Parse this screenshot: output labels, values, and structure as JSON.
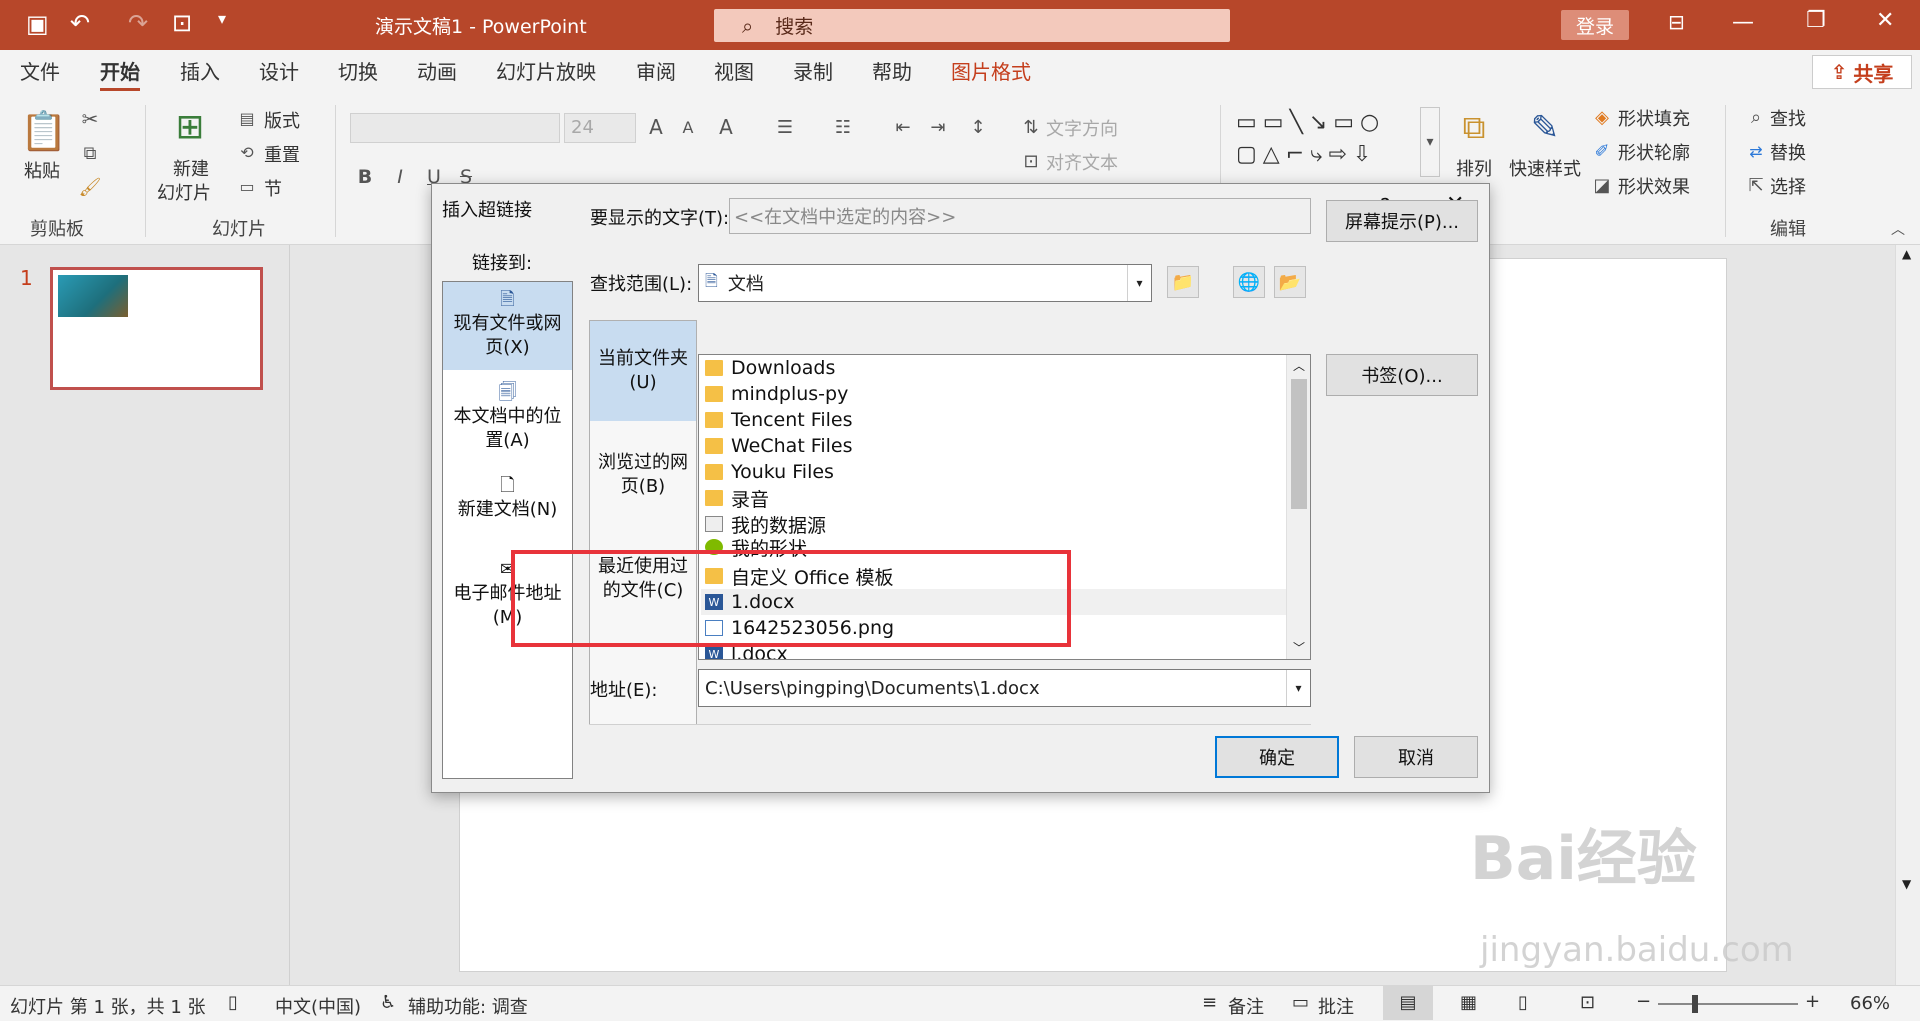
{
  "titlebar": {
    "doc_title": "演示文稿1  -  PowerPoint",
    "search_placeholder": "搜索",
    "login": "登录"
  },
  "tabs": [
    "文件",
    "开始",
    "插入",
    "设计",
    "切换",
    "动画",
    "幻灯片放映",
    "审阅",
    "视图",
    "录制",
    "帮助",
    "图片格式"
  ],
  "share": "共享",
  "ribbon": {
    "paste": "粘贴",
    "clipboard_group": "剪贴板",
    "new_slide_1": "新建",
    "new_slide_2": "幻灯片",
    "layout": "版式",
    "reset": "重置",
    "section": "节",
    "slides_group": "幻灯片",
    "font_size": "24",
    "text_direction": "文字方向",
    "align_text": "对齐文本",
    "arrange": "排列",
    "quick_styles": "快速样式",
    "shape_fill": "形状填充",
    "shape_outline": "形状轮廓",
    "shape_effects": "形状效果",
    "find": "查找",
    "replace": "替换",
    "select": "选择",
    "editing_group": "编辑"
  },
  "slide_number": "1",
  "dialog": {
    "title": "插入超链接",
    "help": "?",
    "close": "✕",
    "link_to": "链接到:",
    "link_items": [
      "现有文件或网页(X)",
      "本文档中的位置(A)",
      "新建文档(N)",
      "电子邮件地址(M)"
    ],
    "display_text_label": "要显示的文字(T):",
    "display_text_value": "<<在文档中选定的内容>>",
    "screen_tip": "屏幕提示(P)...",
    "look_in_label": "查找范围(L):",
    "look_in_value": "文档",
    "scope_items": [
      "当前文件夹(U)",
      "浏览过的网页(B)",
      "最近使用过的文件(C)"
    ],
    "files": [
      {
        "name": "Downloads",
        "type": "folder"
      },
      {
        "name": "mindplus-py",
        "type": "folder"
      },
      {
        "name": "Tencent Files",
        "type": "folder"
      },
      {
        "name": "WeChat Files",
        "type": "folder"
      },
      {
        "name": "Youku Files",
        "type": "folder"
      },
      {
        "name": "录音",
        "type": "folder"
      },
      {
        "name": "我的数据源",
        "type": "db"
      },
      {
        "name": "我的形状",
        "type": "shape"
      },
      {
        "name": "自定义 Office 模板",
        "type": "folder"
      },
      {
        "name": "1.docx",
        "type": "doc"
      },
      {
        "name": "1642523056.png",
        "type": "png"
      },
      {
        "name": "l.docx",
        "type": "doc"
      }
    ],
    "bookmark": "书签(O)...",
    "address_label": "地址(E):",
    "address_value": "C:\\Users\\pingping\\Documents\\1.docx",
    "ok": "确定",
    "cancel": "取消"
  },
  "status": {
    "slide_info": "幻灯片 第 1 张，共 1 张",
    "language": "中文(中国)",
    "accessibility": "辅助功能: 调查",
    "notes": "备注",
    "comments": "批注",
    "zoom": "66%"
  },
  "watermark": {
    "logo": "Bai经验",
    "url": "jingyan.baidu.com"
  }
}
